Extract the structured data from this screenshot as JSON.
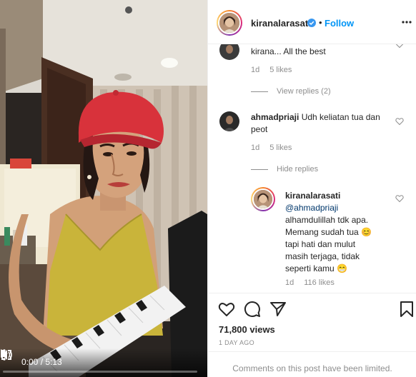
{
  "post": {
    "username": "kiranalarasati",
    "follow_label": "Follow",
    "separator": "•"
  },
  "video": {
    "time": "0:00 / 5:13",
    "progress_fraction": 0.0
  },
  "comments": [
    {
      "text": "kirana... All the best",
      "age": "1d",
      "likes": "5 likes"
    },
    {
      "view_replies": "View replies (2)"
    },
    {
      "username": "ahmadpriaji",
      "text_line1": "Udh keliatan tua dan",
      "text_line2": "peot",
      "age": "1d",
      "likes": "5 likes"
    },
    {
      "hide_replies": "Hide replies"
    },
    {
      "username": "kiranalarasati",
      "mention": "@ahmadpriaji",
      "line1": "alhamdulillah tdk apa.",
      "line2": "Memang sudah tua 😊",
      "line3": "tapi hati dan mulut",
      "line4": "masih terjaga, tidak",
      "line5": "seperti kamu 😁",
      "age": "1d",
      "likes": "116 likes"
    }
  ],
  "stats": {
    "views": "71,800 views",
    "ago": "1 DAY AGO"
  },
  "footer": {
    "text": "Comments on this post have been limited."
  },
  "colors": {
    "accent": "#0095f6",
    "muted": "#8e8e8e",
    "text": "#262626",
    "verified": "#3897f0"
  }
}
